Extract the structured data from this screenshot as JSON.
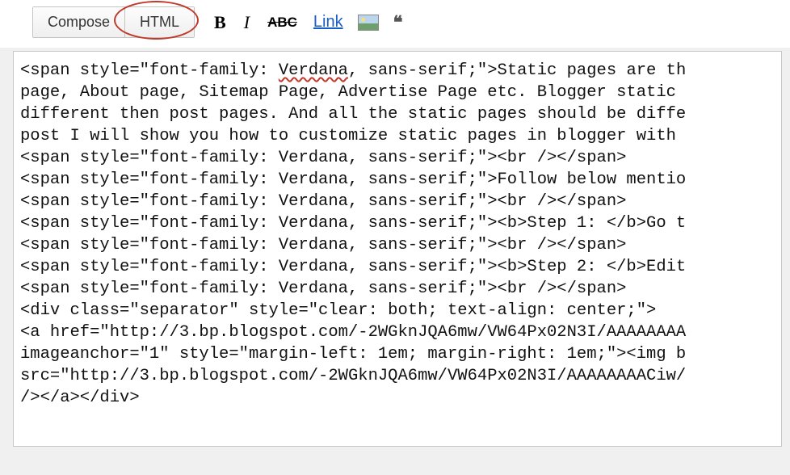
{
  "toolbar": {
    "compose_label": "Compose",
    "html_label": "HTML",
    "bold_label": "B",
    "italic_label": "I",
    "strike_label": "ABC",
    "link_label": "Link",
    "quote_glyph": "❝"
  },
  "code": {
    "l1a": "<span style=\"font-family: ",
    "l1_verdana": "Verdana",
    "l1b": ", sans-serif;\">Static pages are th",
    "l2": "page, About page, Sitemap Page, Advertise Page etc. Blogger static ",
    "l3": "different then post pages. And all the static pages should be diffe",
    "l4": "post I will show you how to customize static pages in blogger with ",
    "l5": "<span style=\"font-family: Verdana, sans-serif;\"><br /></span>",
    "l6": "<span style=\"font-family: Verdana, sans-serif;\">Follow below mentio",
    "l7": "<span style=\"font-family: Verdana, sans-serif;\"><br /></span>",
    "l8": "<span style=\"font-family: Verdana, sans-serif;\"><b>Step 1: </b>Go t",
    "l9": "<span style=\"font-family: Verdana, sans-serif;\"><br /></span>",
    "l10": "<span style=\"font-family: Verdana, sans-serif;\"><b>Step 2: </b>Edit",
    "l11": "<span style=\"font-family: Verdana, sans-serif;\"><br /></span>",
    "l12": "<div class=\"separator\" style=\"clear: both; text-align: center;\">",
    "l13": "<a href=\"http://3.bp.blogspot.com/-2WGknJQA6mw/VW64Px02N3I/AAAAAAAA",
    "l14": "imageanchor=\"1\" style=\"margin-left: 1em; margin-right: 1em;\"><img b",
    "l15": "src=\"http://3.bp.blogspot.com/-2WGknJQA6mw/VW64Px02N3I/AAAAAAAACiw/",
    "l16": "/></a></div>"
  }
}
